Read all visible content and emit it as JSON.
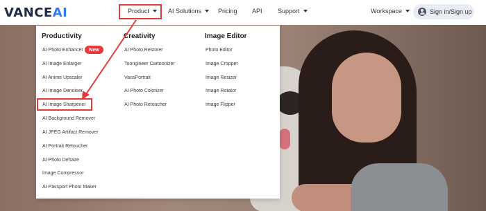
{
  "logo": {
    "part1": "VANCE",
    "part2": "AI"
  },
  "nav": {
    "product": "Product",
    "ai_solutions": "AI Solutions",
    "pricing": "Pricing",
    "api": "API",
    "support": "Support",
    "workspace": "Workspace",
    "signin": "Sign in/Sign up"
  },
  "menu": {
    "productivity": {
      "title": "Productivity",
      "items": [
        "AI Photo Enhancer",
        "AI Image Enlarger",
        "AI Anime Upscaler",
        "AI Image Denoiser",
        "AI Image Sharpener",
        "AI Background Remover",
        "AI JPEG Artifact Remover",
        "AI Portrait Retoucher",
        "AI Photo Dehaze",
        "Image Compressor",
        "AI Passport Photo Maker"
      ],
      "badge": "New"
    },
    "creativity": {
      "title": "Creativity",
      "items": [
        "AI Photo Restorer",
        "Toongineer Cartoonizer",
        "VansPortrait",
        "AI Photo Colorizer",
        "AI Photo Retoucher"
      ]
    },
    "image_editor": {
      "title": "Image Editor",
      "items": [
        "Photo Editor",
        "Image Cropper",
        "Image Resizer",
        "Image Rotator",
        "Image Flipper"
      ]
    }
  },
  "colors": {
    "brand_dark": "#1f2a44",
    "brand_blue": "#2f7cf6",
    "highlight_red": "#e23b3b",
    "badge_red": "#e63c3c"
  }
}
